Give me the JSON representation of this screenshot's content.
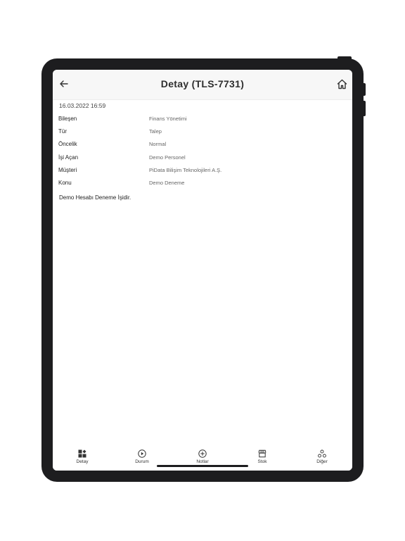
{
  "header": {
    "title": "Detay (TLS-7731)"
  },
  "detail": {
    "date": "16.03.2022 16:59",
    "rows": [
      {
        "label": "Bileşen",
        "value": "Finans Yönetimi"
      },
      {
        "label": "Tür",
        "value": "Talep"
      },
      {
        "label": "Öncelik",
        "value": "Normal"
      },
      {
        "label": "İşi Açan",
        "value": "Demo Personel"
      },
      {
        "label": "Müşteri",
        "value": "PiData Bilişim Teknolojileri A.Ş."
      },
      {
        "label": "Konu",
        "value": "Demo Deneme"
      }
    ],
    "description": "Demo Hesabı Deneme İşidir."
  },
  "tabbar": {
    "items": [
      {
        "label": "Detay",
        "icon": "grid-icon"
      },
      {
        "label": "Durum",
        "icon": "play-circle-icon"
      },
      {
        "label": "Notlar",
        "icon": "plus-circle-icon"
      },
      {
        "label": "Stok",
        "icon": "store-icon"
      },
      {
        "label": "Diğer",
        "icon": "dots-icon"
      }
    ]
  },
  "colors": {
    "frame": "#1d1d1f",
    "header_bg": "#f7f7f7",
    "text_primary": "#222222",
    "text_secondary": "#666666"
  }
}
